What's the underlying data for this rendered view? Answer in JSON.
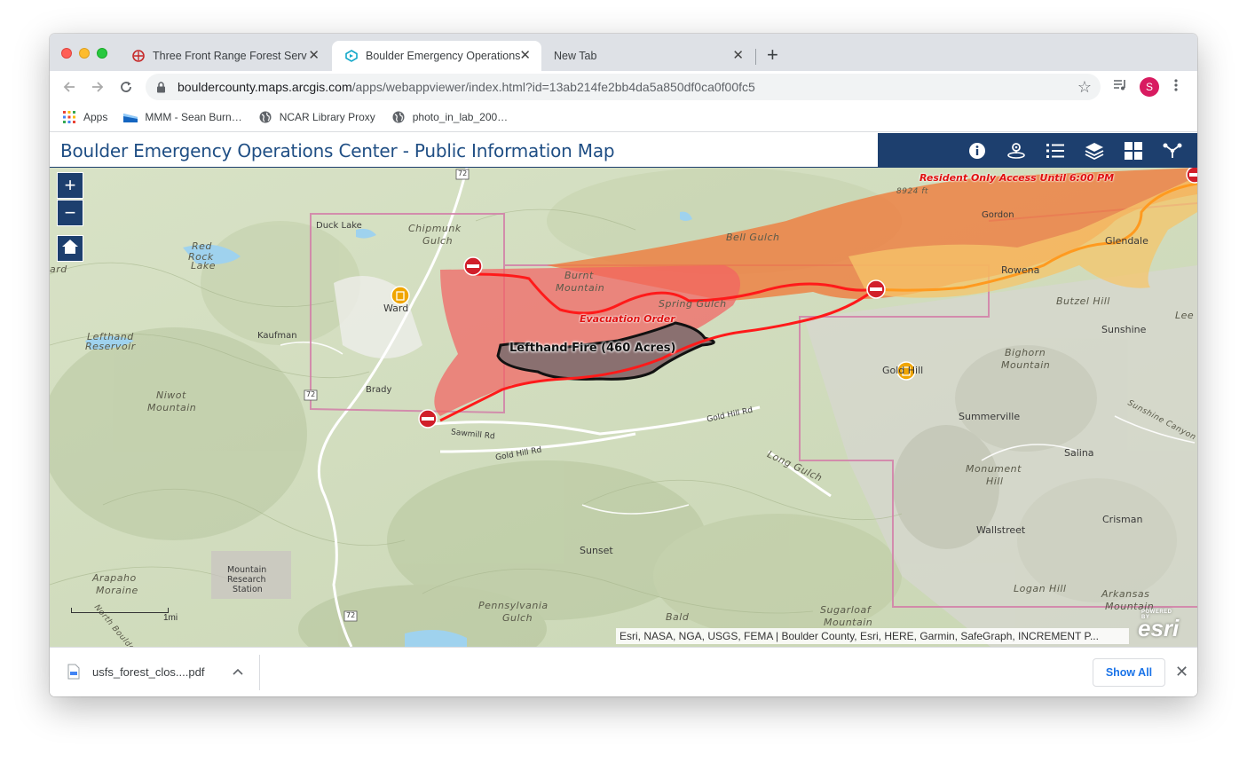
{
  "browser": {
    "tabs": [
      {
        "title": "Three Front Range Forest Serv",
        "active": false,
        "icon": "usfs-icon"
      },
      {
        "title": "Boulder Emergency Operations",
        "active": true,
        "icon": "webappbuilder-icon"
      },
      {
        "title": "New Tab",
        "active": false,
        "icon": ""
      }
    ],
    "url_domain": "bouldercounty.maps.arcgis.com",
    "url_path": "/apps/webappviewer/index.html?id=13ab214fe2bb4da5a850df0ca0f00fc5",
    "profile_initial": "S",
    "bookmarks": [
      {
        "label": "Apps",
        "icon": "apps-grid-icon"
      },
      {
        "label": "MMM - Sean Burn…",
        "icon": "mmm-icon"
      },
      {
        "label": "NCAR Library Proxy",
        "icon": "globe-icon"
      },
      {
        "label": "photo_in_lab_200…",
        "icon": "globe-icon"
      }
    ]
  },
  "app": {
    "title": "Boulder Emergency Operations Center - Public Information Map",
    "widgets": [
      "info-icon",
      "analysis-icon",
      "legend-icon",
      "layers-icon",
      "basemap-gallery-icon",
      "share-icon"
    ],
    "colors": {
      "header_blue": "#1d3f6e",
      "title_blue": "#1f4e84"
    }
  },
  "map": {
    "zoom_in": "+",
    "zoom_out": "−",
    "labels": {
      "resident_only": "Resident Only Access Until 6:00 PM",
      "evacuation": "Evacuation Order",
      "fire": "Lefthand Fire (460 Acres)",
      "duck_lake": "Duck Lake",
      "chipmunk": "Chipmunk",
      "gulch1": "Gulch",
      "red": "Red",
      "rock": "Rock",
      "lake": "Lake",
      "lefthand": "Lefthand",
      "reservoir": "Reservoir",
      "ward": "Ward",
      "kaufman": "Kaufman",
      "niwot": "Niwot",
      "mountain1": "Mountain",
      "brady": "Brady",
      "burnt": "Burnt",
      "mountain2": "Mountain",
      "spring_gulch": "Spring Gulch",
      "bell_gulch": "Bell Gulch",
      "gordon": "Gordon",
      "glendale": "Glendale",
      "rowena": "Rowena",
      "butzel_hill": "Butzel Hill",
      "lee": "Lee",
      "sunshine": "Sunshine",
      "bighorn": "Bighorn",
      "mountain3": "Mountain",
      "gold_hill": "Gold Hill",
      "gold_hill_rd": "Gold Hill Rd",
      "gold_hill_rd2": "Gold Hill Rd",
      "sawmill": "Sawmill Rd",
      "long_gulch": "Long Gulch",
      "summerville": "Summerville",
      "sunshine_canyon": "Sunshine Canyon",
      "salina": "Salina",
      "monument": "Monument",
      "hill": "Hill",
      "crisman": "Crisman",
      "wallstreet": "Wallstreet",
      "logan_hill": "Logan Hill",
      "arkansas": "Arkansas",
      "mountain4": "Mountain",
      "sunset": "Sunset",
      "arapaho": "Arapaho",
      "moraine": "Moraine",
      "mrs1": "Mountain",
      "mrs2": "Research",
      "mrs3": "Station",
      "pennsylvania": "Pennsylvania",
      "gulch2": "Gulch",
      "bald": "Bald",
      "sugarloaf": "Sugarloaf",
      "mountain5": "Mountain",
      "elev": "8924 ft",
      "hwy72a": "72",
      "hwy72b": "72",
      "hwy72c": "72",
      "ard": "ard",
      "north_boulder": "North Boulde",
      "scale": "1mi"
    },
    "attribution": "Esri, NASA, NGA, USGS, FEMA | Boulder County, Esri, HERE, Garmin, SafeGraph, INCREMENT P...",
    "esri_powered": "POWERED BY",
    "esri_logo": "esri"
  },
  "downloads": {
    "file": "usfs_forest_clos....pdf",
    "show_all": "Show All"
  }
}
